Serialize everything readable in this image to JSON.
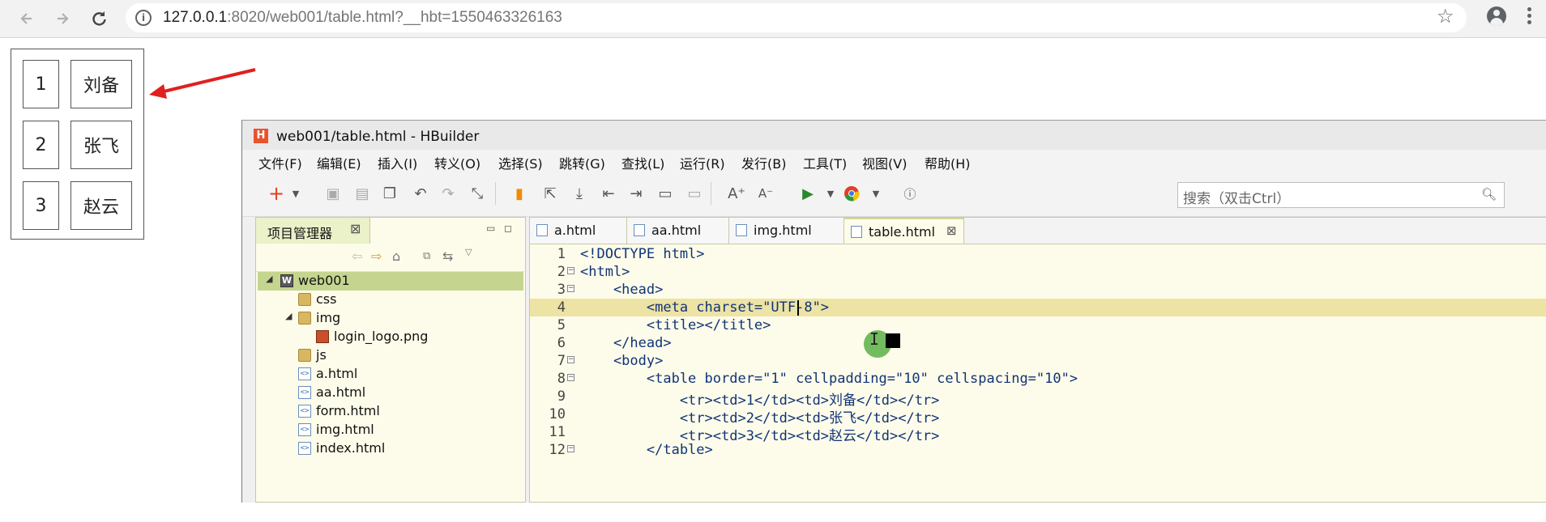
{
  "browser": {
    "url_host": "127.0.0.1",
    "url_rest": ":8020/web001/table.html?__hbt=1550463326163",
    "icons": [
      "back-arrow-icon",
      "forward-arrow-icon",
      "reload-icon",
      "info-icon",
      "bookmark-star-icon",
      "profile-icon",
      "kebab-menu-icon"
    ]
  },
  "rendered_table": {
    "rows": [
      {
        "num": "1",
        "name": "刘备"
      },
      {
        "num": "2",
        "name": "张飞"
      },
      {
        "num": "3",
        "name": "赵云"
      }
    ]
  },
  "annotation_color": "#e02020",
  "ide": {
    "title": "web001/table.html - HBuilder",
    "logo": "H",
    "menu": [
      "文件(F)",
      "编辑(E)",
      "插入(I)",
      "转义(O)",
      "选择(S)",
      "跳转(G)",
      "查找(L)",
      "运行(R)",
      "发行(B)",
      "工具(T)",
      "视图(V)",
      "帮助(H)"
    ],
    "search_placeholder": "搜索（双击Ctrl）",
    "explorer": {
      "tab_label": "项目管理器",
      "tree": [
        {
          "name": "web001",
          "type": "project",
          "depth": 0,
          "expanded": true,
          "selected": true
        },
        {
          "name": "css",
          "type": "folder",
          "depth": 1
        },
        {
          "name": "img",
          "type": "folder",
          "depth": 1,
          "expanded": true
        },
        {
          "name": "login_logo.png",
          "type": "png",
          "depth": 2
        },
        {
          "name": "js",
          "type": "folder",
          "depth": 1
        },
        {
          "name": "a.html",
          "type": "file",
          "depth": 1
        },
        {
          "name": "aa.html",
          "type": "file",
          "depth": 1
        },
        {
          "name": "form.html",
          "type": "file",
          "depth": 1
        },
        {
          "name": "img.html",
          "type": "file",
          "depth": 1
        },
        {
          "name": "index.html",
          "type": "file",
          "depth": 1
        }
      ]
    },
    "editor_tabs": [
      {
        "label": "a.html",
        "active": false
      },
      {
        "label": "aa.html",
        "active": false
      },
      {
        "label": "img.html",
        "active": false
      },
      {
        "label": "table.html",
        "active": true,
        "closable": true
      }
    ],
    "code_lines": [
      {
        "n": "1",
        "fold": false,
        "text": "<!DOCTYPE html>"
      },
      {
        "n": "2",
        "fold": true,
        "text": "<html>"
      },
      {
        "n": "3",
        "fold": true,
        "text": "    <head>"
      },
      {
        "n": "4",
        "fold": false,
        "text": "        <meta charset=\"UTF-8\">",
        "highlight": true
      },
      {
        "n": "5",
        "fold": false,
        "text": "        <title></title>"
      },
      {
        "n": "6",
        "fold": false,
        "text": "    </head>"
      },
      {
        "n": "7",
        "fold": true,
        "text": "    <body>"
      },
      {
        "n": "8",
        "fold": true,
        "text": "        <table border=\"1\" cellpadding=\"10\" cellspacing=\"10\">"
      },
      {
        "n": "9",
        "fold": false,
        "text": "            <tr><td>1</td><td>刘备</td></tr>"
      },
      {
        "n": "10",
        "fold": false,
        "text": "            <tr><td>2</td><td>张飞</td></tr>"
      },
      {
        "n": "11",
        "fold": false,
        "text": "            <tr><td>3</td><td>赵云</td></tr>"
      },
      {
        "n": "12",
        "fold": true,
        "text": "        </table>"
      }
    ]
  }
}
